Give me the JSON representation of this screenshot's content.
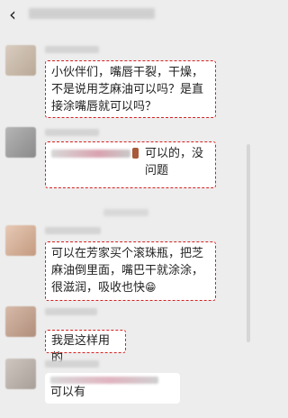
{
  "header": {
    "back_icon": "‹"
  },
  "messages": [
    {
      "text": "小伙伴们，嘴唇干裂，干燥，不是说用芝麻油可以吗？是直接涂嘴唇就可以吗？"
    },
    {
      "text": "可以的，没问题"
    },
    {
      "text": "可以在芳家买个滚珠瓶，把芝麻油倒里面，嘴巴干就涂涂，很滋润，吸收也快",
      "emoji": "😁"
    },
    {
      "text": "我是这样用的"
    },
    {
      "text": "可以有"
    }
  ],
  "colors": {
    "highlight_dash": "#d62020",
    "bubble_bg": "#ffffff",
    "page_bg": "#ededed"
  }
}
